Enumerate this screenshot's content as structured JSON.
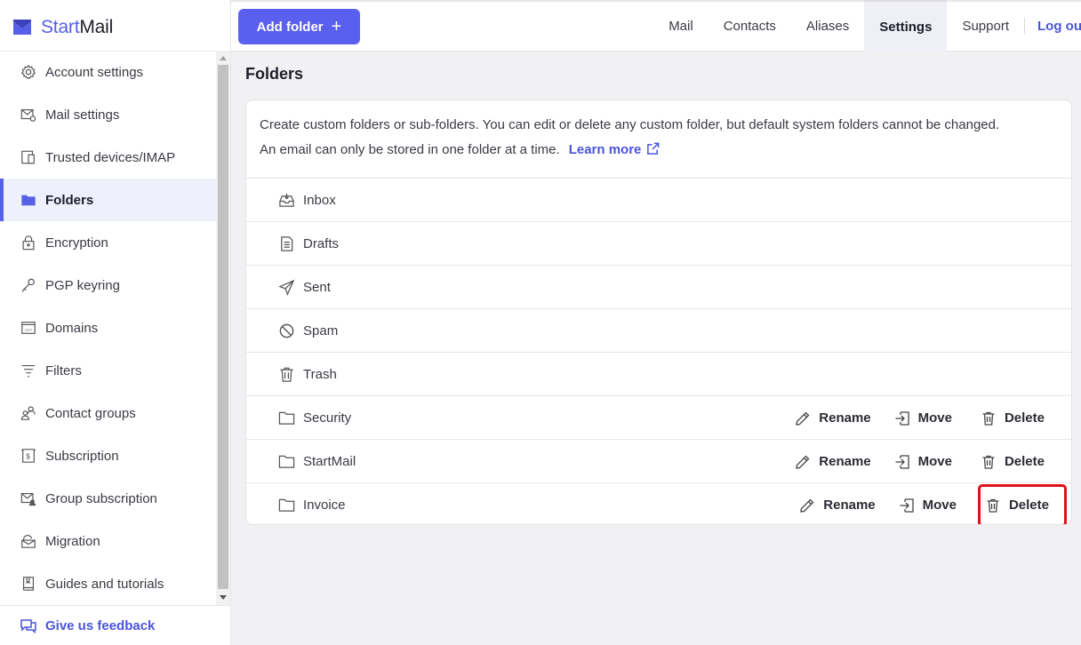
{
  "app": {
    "logo_start": "Start",
    "logo_mail": "Mail"
  },
  "sidebar": {
    "items": [
      {
        "label": "Account settings",
        "icon": "gear-icon"
      },
      {
        "label": "Mail settings",
        "icon": "mail-settings-icon"
      },
      {
        "label": "Trusted devices/IMAP",
        "icon": "devices-icon"
      },
      {
        "label": "Folders",
        "icon": "folder-icon",
        "active": true
      },
      {
        "label": "Encryption",
        "icon": "lock-icon"
      },
      {
        "label": "PGP keyring",
        "icon": "key-icon"
      },
      {
        "label": "Domains",
        "icon": "domain-icon"
      },
      {
        "label": "Filters",
        "icon": "filter-icon"
      },
      {
        "label": "Contact groups",
        "icon": "contacts-group-icon"
      },
      {
        "label": "Subscription",
        "icon": "subscription-icon"
      },
      {
        "label": "Group subscription",
        "icon": "group-subscription-icon"
      },
      {
        "label": "Migration",
        "icon": "migration-icon"
      },
      {
        "label": "Guides and tutorials",
        "icon": "book-icon"
      }
    ],
    "feedback_label": "Give us feedback"
  },
  "toolbar": {
    "add_folder_label": "Add folder",
    "add_folder_plus": "+"
  },
  "tabs": [
    {
      "label": "Mail"
    },
    {
      "label": "Contacts"
    },
    {
      "label": "Aliases"
    },
    {
      "label": "Settings",
      "active": true
    },
    {
      "label": "Support"
    },
    {
      "label": "Log out"
    }
  ],
  "main": {
    "title": "Folders",
    "description_line1": "Create custom folders or sub-folders. You can edit or delete any custom folder, but default system folders cannot be changed.",
    "description_line2": "An email can only be stored in one folder at a time.",
    "learn_more": "Learn more",
    "folders": [
      {
        "name": "Inbox",
        "icon": "inbox-icon",
        "system": true
      },
      {
        "name": "Drafts",
        "icon": "drafts-icon",
        "system": true
      },
      {
        "name": "Sent",
        "icon": "sent-icon",
        "system": true
      },
      {
        "name": "Spam",
        "icon": "spam-icon",
        "system": true
      },
      {
        "name": "Trash",
        "icon": "trash-icon",
        "system": true
      },
      {
        "name": "Security",
        "icon": "folder-icon",
        "system": false
      },
      {
        "name": "StartMail",
        "icon": "folder-icon",
        "system": false
      },
      {
        "name": "Invoice",
        "icon": "folder-icon",
        "system": false
      }
    ],
    "actions": {
      "rename": "Rename",
      "move": "Move",
      "delete": "Delete"
    }
  },
  "colors": {
    "accent": "#5a5ff0",
    "link": "#4a55d9",
    "highlight": "#e0101a"
  }
}
